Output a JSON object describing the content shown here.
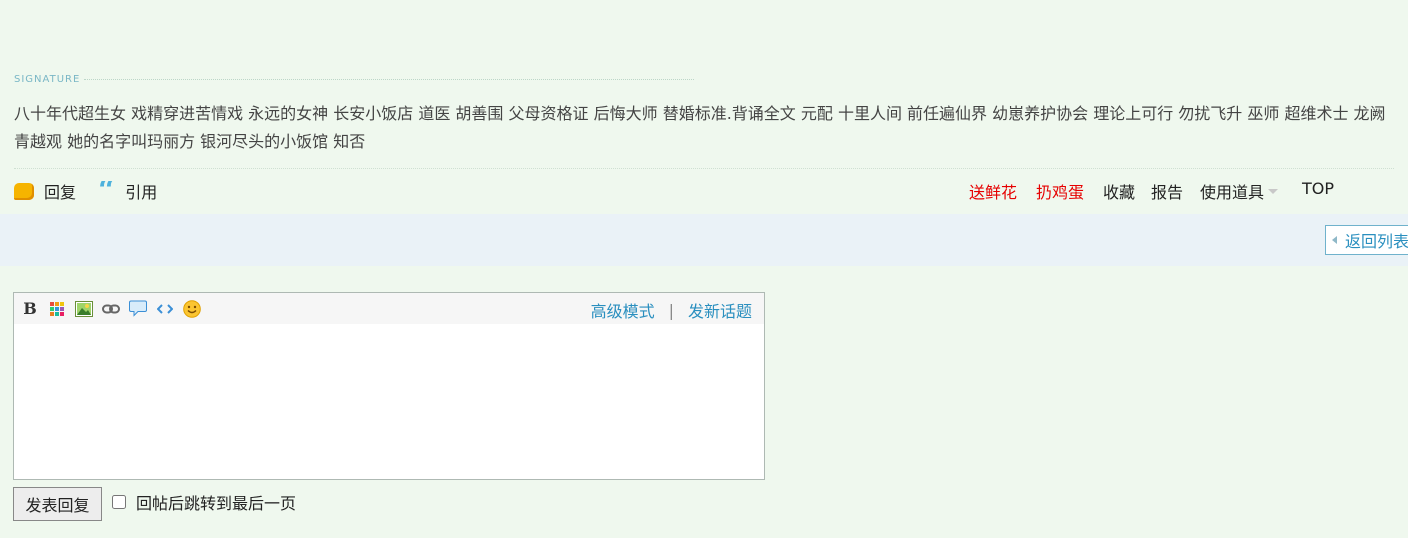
{
  "signature": {
    "label": "SIGNATURE",
    "text": "八十年代超生女 戏精穿进苦情戏   永远的女神 长安小饭店 道医 胡善围  父母资格证 后悔大师  替婚标准.背诵全文  元配 十里人间 前任遍仙界  幼崽养护协会 理论上可行 勿扰飞升  巫师 超维术士  龙阙  青越观   她的名字叫玛丽方   银河尽头的小饭馆  知否"
  },
  "actions": {
    "reply": "回复",
    "quote": "引用",
    "send_flower": "送鲜花",
    "throw_egg": "扔鸡蛋",
    "favorite": "收藏",
    "report": "报告",
    "use_tools": "使用道具",
    "top": "TOP"
  },
  "nav": {
    "back_to_list": "返回列表"
  },
  "editor": {
    "advanced_mode": "高级模式",
    "separator": "|",
    "new_topic": "发新话题",
    "toolbar_icons": [
      "bold-icon",
      "color-icon",
      "image-icon",
      "link-icon",
      "quote-icon",
      "code-icon",
      "smiley-icon"
    ],
    "content": ""
  },
  "submit": {
    "button": "发表回复",
    "jump_label": "回帖后跳转到最后一页"
  },
  "colors": {
    "background": "#eff8ee",
    "link_blue": "#2a8fbf",
    "red": "#e60000",
    "band": "#eaf2f7"
  }
}
